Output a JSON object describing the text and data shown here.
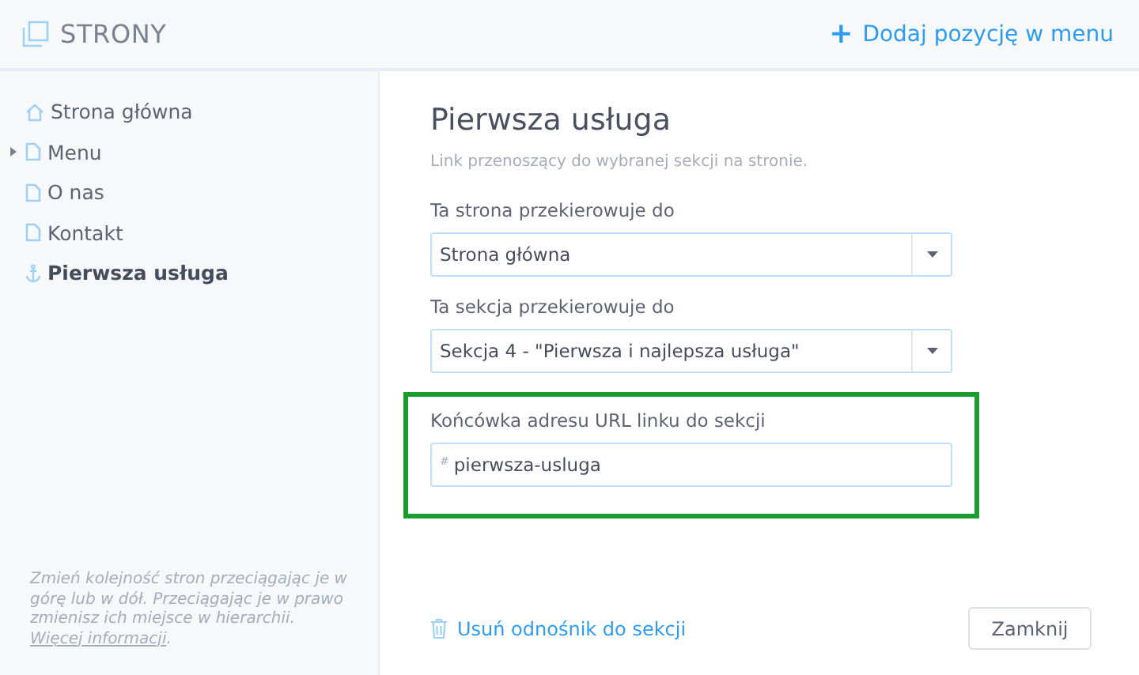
{
  "header": {
    "title": "STRONY",
    "add_button": {
      "icon": "+",
      "label": "Dodaj pozycję w menu"
    }
  },
  "sidebar": {
    "items": [
      {
        "label": "Strona główna",
        "kind": "home",
        "selected": false
      },
      {
        "label": "Menu",
        "kind": "page",
        "selected": false,
        "expanded": false
      },
      {
        "label": "O nas",
        "kind": "page",
        "selected": false
      },
      {
        "label": "Kontakt",
        "kind": "page",
        "selected": false
      },
      {
        "label": "Pierwsza usługa",
        "kind": "anchor",
        "selected": true
      }
    ],
    "hint": {
      "text": "Zmień kolejność stron przeciągając je w górę lub w dół. Przeciągając je w prawo zmienisz ich miejsce w hierarchii. ",
      "link": "Więcej informacji",
      "after": "."
    }
  },
  "panel": {
    "title": "Pierwsza usługa",
    "subtitle": "Link przenoszący do wybranej sekcji na stronie.",
    "fields": [
      {
        "kind": "select",
        "label": "Ta strona przekierowuje do",
        "value": "Strona główna",
        "highlighted": false
      },
      {
        "kind": "select",
        "label": "Ta sekcja przekierowuje do",
        "value": "Sekcja 4 - \"Pierwsza i najlepsza usługa\"",
        "highlighted": false
      },
      {
        "kind": "text",
        "label": "Końcówka adresu URL linku do sekcji",
        "prefix": "#",
        "value": "pierwsza-usluga",
        "highlighted": true
      }
    ],
    "delete_link": "Usuń odnośnik do sekcji",
    "close_button": "Zamknij"
  }
}
